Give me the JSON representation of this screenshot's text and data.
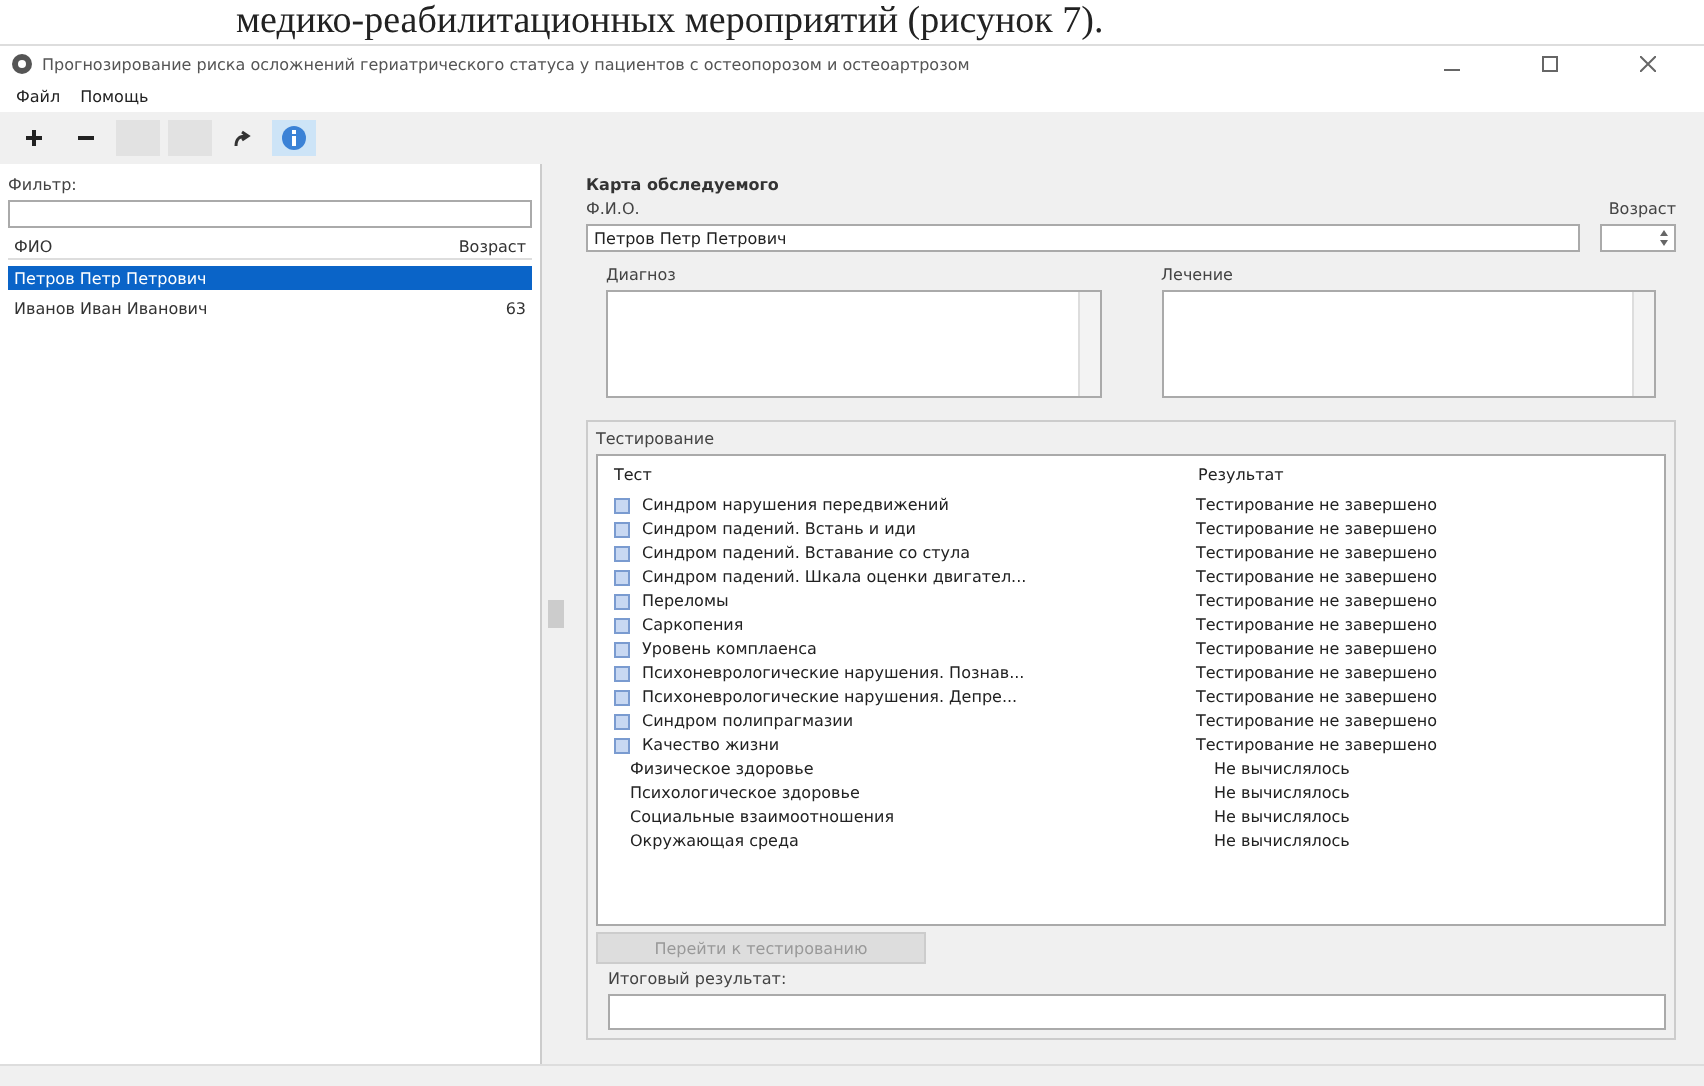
{
  "caption": "медико-реабилитационных мероприятий (рисунок 7).",
  "window": {
    "title": "Прогнозирование риска осложнений гериатрического статуса у пациентов с остеопорозом и остеоартрозом"
  },
  "menu": [
    "Файл",
    "Помощь"
  ],
  "toolbar": [
    {
      "kind": "add",
      "disabled": false
    },
    {
      "kind": "remove",
      "disabled": false
    },
    {
      "kind": "blank",
      "disabled": true
    },
    {
      "kind": "blank",
      "disabled": true
    },
    {
      "kind": "refresh",
      "disabled": false
    },
    {
      "kind": "info",
      "disabled": false,
      "selected": true
    }
  ],
  "sidebar": {
    "filter_label": "Фильтр:",
    "columns": [
      "ФИО",
      "Возраст"
    ],
    "rows": [
      {
        "name": "Петров Петр Петрович",
        "age": "",
        "selected": true
      },
      {
        "name": "Иванов Иван Иванович",
        "age": "63",
        "selected": false
      }
    ]
  },
  "card": {
    "title": "Карта обследуемого",
    "fio_label": "Ф.И.О.",
    "fio_value": "Петров Петр Петрович",
    "age_label": "Возраст",
    "diagnosis_label": "Диагноз",
    "treatment_label": "Лечение",
    "testing": {
      "label": "Тестирование",
      "columns": [
        "Тест",
        "Результат"
      ],
      "rows": [
        {
          "name": "Синдром нарушения передвижений",
          "result": "Тестирование не завершено"
        },
        {
          "name": "Синдром падений. Встань и иди",
          "result": "Тестирование не завершено"
        },
        {
          "name": "Синдром падений. Вставание со стула",
          "result": "Тестирование не завершено"
        },
        {
          "name": "Синдром падений. Шкала оценки двигател...",
          "result": "Тестирование не завершено"
        },
        {
          "name": "Переломы",
          "result": "Тестирование не завершено"
        },
        {
          "name": "Саркопения",
          "result": "Тестирование не завершено"
        },
        {
          "name": "Уровень комплаенса",
          "result": "Тестирование не завершено"
        },
        {
          "name": "Психоневрологические нарушения. Познав...",
          "result": "Тестирование не завершено"
        },
        {
          "name": "Психоневрологические нарушения. Депре...",
          "result": "Тестирование не завершено"
        },
        {
          "name": "Синдром полипрагмазии",
          "result": "Тестирование не завершено"
        },
        {
          "name": "Качество жизни",
          "result": "Тестирование не завершено",
          "children": [
            {
              "name": "Физическое здоровье",
              "result": "Не вычислялось"
            },
            {
              "name": "Психологическое здоровье",
              "result": "Не вычислялось"
            },
            {
              "name": "Социальные взаимоотношения",
              "result": "Не вычислялось"
            },
            {
              "name": "Окружающая среда",
              "result": "Не вычислялось"
            }
          ]
        }
      ]
    },
    "start_button": {
      "label": "Перейти к тестированию",
      "disabled": true
    },
    "result_label": "Итоговый результат:"
  }
}
